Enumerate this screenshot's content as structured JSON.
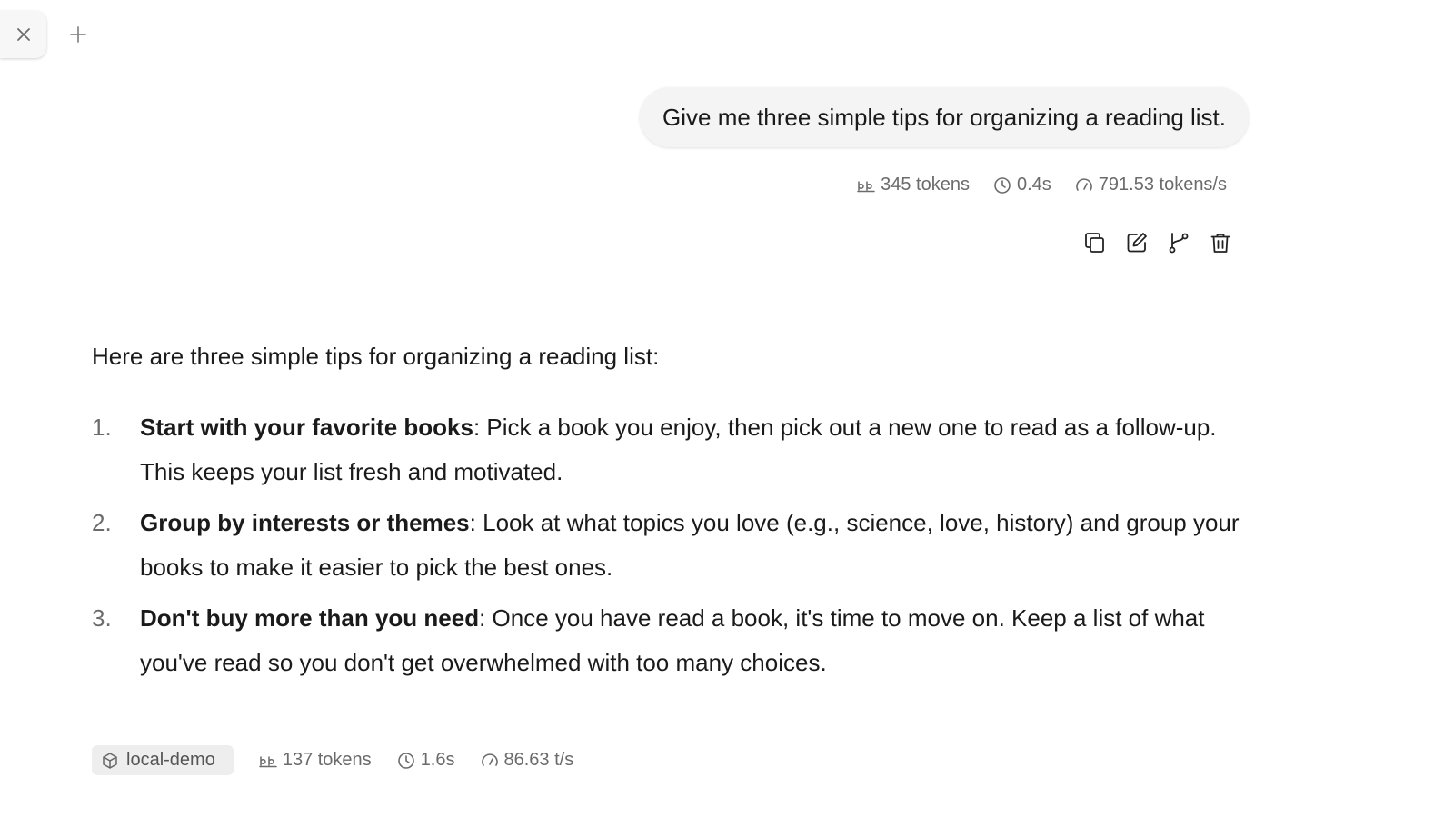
{
  "user_message": {
    "text": "Give me three simple tips for organizing a reading list.",
    "stats": {
      "tokens": "345 tokens",
      "time": "0.4s",
      "speed": "791.53 tokens/s"
    }
  },
  "assistant_message": {
    "intro": "Here are three simple tips for organizing a reading list:",
    "tips": [
      {
        "number": "1.",
        "title": "Start with your favorite books",
        "text": ": Pick a book you enjoy, then pick out a new one to read as a follow-up. This keeps your list fresh and motivated."
      },
      {
        "number": "2.",
        "title": "Group by interests or themes",
        "text": ": Look at what topics you love (e.g., science, love, history) and group your books to make it easier to pick the best ones."
      },
      {
        "number": "3.",
        "title": "Don't buy more than you need",
        "text": ": Once you have read a book, it's time to move on. Keep a list of what you've read so you don't get overwhelmed with too many choices."
      }
    ],
    "meta": {
      "model": "local-demo",
      "tokens": "137 tokens",
      "time": "1.6s",
      "speed": "86.63 t/s"
    }
  },
  "icons": {
    "close": "close-icon",
    "add": "plus-icon",
    "copy": "copy-icon",
    "edit": "edit-icon",
    "branch": "branch-icon",
    "delete": "trash-icon",
    "tokens": "tokens-icon",
    "time": "clock-icon",
    "speed": "gauge-icon",
    "model": "cube-icon"
  },
  "colors": {
    "muted_text": "#6b6b6b",
    "bubble_bg": "#f4f4f4",
    "chip_bg": "#eeeeee"
  }
}
